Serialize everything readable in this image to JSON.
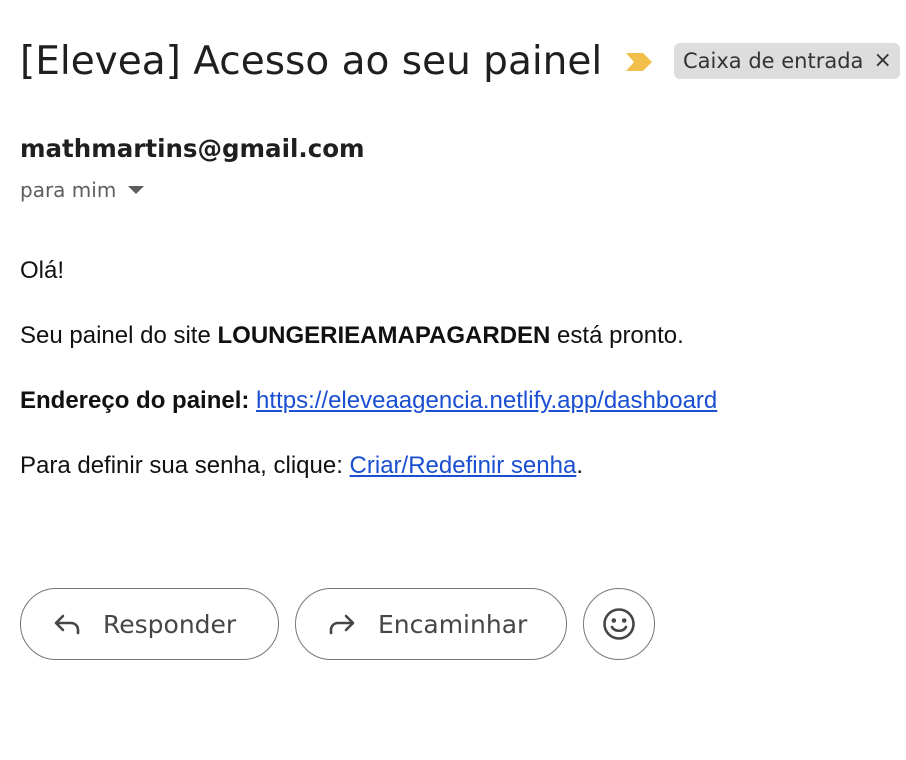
{
  "email": {
    "subject": "[Elevea] Acesso ao seu painel",
    "label_chip": {
      "text": "Caixa de entrada",
      "close_glyph": "×"
    },
    "importance_marker_icon": "importance-marker-icon",
    "sender": "mathmartins@gmail.com",
    "recipient_text": "para mim",
    "body": {
      "greeting": "Olá!",
      "panel_prefix": "Seu painel do site ",
      "site_name": "LOUNGERIEAMAPAGARDEN",
      "panel_suffix": " está pronto.",
      "address_label": "Endereço do painel:",
      "address_link": "https://eleveaagencia.netlify.app/dashboard",
      "password_prefix": "Para definir sua senha, clique: ",
      "password_link": "Criar/Redefinir senha",
      "password_suffix": "."
    }
  },
  "actions": {
    "reply_label": "Responder",
    "forward_label": "Encaminhar",
    "reply_icon": "reply-icon",
    "forward_icon": "forward-icon",
    "emoji_icon": "emoji-reaction-icon"
  },
  "colors": {
    "link": "#1a4fd1",
    "importance_marker": "#f2c04a",
    "chip_background": "#dddddd",
    "button_border": "#747775"
  }
}
